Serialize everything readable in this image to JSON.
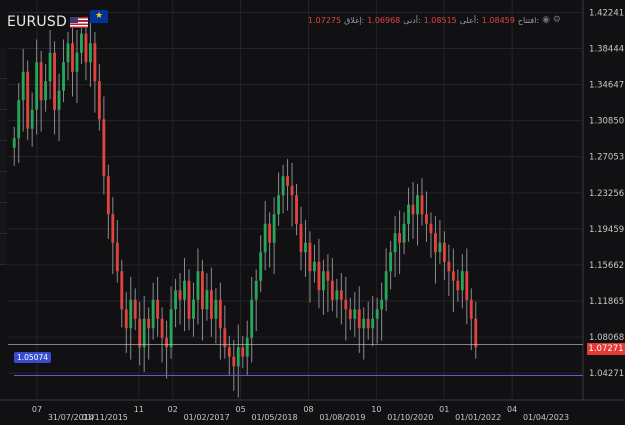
{
  "symbol": {
    "name": "EURUSD",
    "base_flag": "eu-flag-icon",
    "quote_flag": "us-flag-icon"
  },
  "ohlc": {
    "open_label": "افتتاح:",
    "open": "1.08459",
    "high_label": "أعلى:",
    "high": "1.08515",
    "low_label": "أدنى:",
    "low": "1.06968",
    "close_label": "إغلاق:",
    "close": "1.07275",
    "icons": [
      "eye-icon",
      "settings-icon"
    ]
  },
  "current_price_tag": "1.07271",
  "horizontal_line_tag": "1.05074",
  "colors": {
    "up": "#26a65b",
    "down": "#e0443e",
    "background": "#111114",
    "grid": "#24242a",
    "hline": "#5a5fd0",
    "tag_bg": "#3a4bd0"
  },
  "chart_data": {
    "type": "candlestick",
    "y_ticks": [
      "1.42241",
      "1.38444",
      "1.34647",
      "1.30850",
      "1.27053",
      "1.23256",
      "1.19459",
      "1.15662",
      "1.11865",
      "1.08068",
      "1.04271"
    ],
    "ylim": [
      1.025,
      1.425
    ],
    "x_ticks": [
      "07",
      "31/07/2014",
      "01/11/2015",
      "11",
      "02",
      "01/02/2017",
      "05",
      "01/05/2018",
      "08",
      "01/08/2019",
      "10",
      "01/10/2020",
      "01",
      "01/01/2022",
      "04",
      "01/04/2023"
    ],
    "horizontal_line": 1.05074,
    "last_price": 1.07271,
    "closes": [
      1.29,
      1.33,
      1.36,
      1.3,
      1.32,
      1.37,
      1.33,
      1.35,
      1.38,
      1.32,
      1.34,
      1.37,
      1.39,
      1.36,
      1.38,
      1.4,
      1.37,
      1.39,
      1.35,
      1.31,
      1.25,
      1.21,
      1.18,
      1.15,
      1.11,
      1.09,
      1.12,
      1.1,
      1.07,
      1.1,
      1.09,
      1.12,
      1.1,
      1.08,
      1.07,
      1.11,
      1.13,
      1.12,
      1.14,
      1.1,
      1.12,
      1.15,
      1.11,
      1.13,
      1.1,
      1.12,
      1.09,
      1.07,
      1.06,
      1.05,
      1.07,
      1.06,
      1.08,
      1.12,
      1.14,
      1.17,
      1.2,
      1.18,
      1.21,
      1.23,
      1.25,
      1.24,
      1.23,
      1.2,
      1.17,
      1.18,
      1.15,
      1.16,
      1.13,
      1.15,
      1.14,
      1.12,
      1.13,
      1.12,
      1.11,
      1.1,
      1.11,
      1.09,
      1.1,
      1.09,
      1.1,
      1.11,
      1.12,
      1.15,
      1.17,
      1.19,
      1.18,
      1.2,
      1.22,
      1.21,
      1.23,
      1.21,
      1.2,
      1.19,
      1.17,
      1.18,
      1.16,
      1.15,
      1.14,
      1.13,
      1.15,
      1.12,
      1.1,
      1.07
    ]
  }
}
